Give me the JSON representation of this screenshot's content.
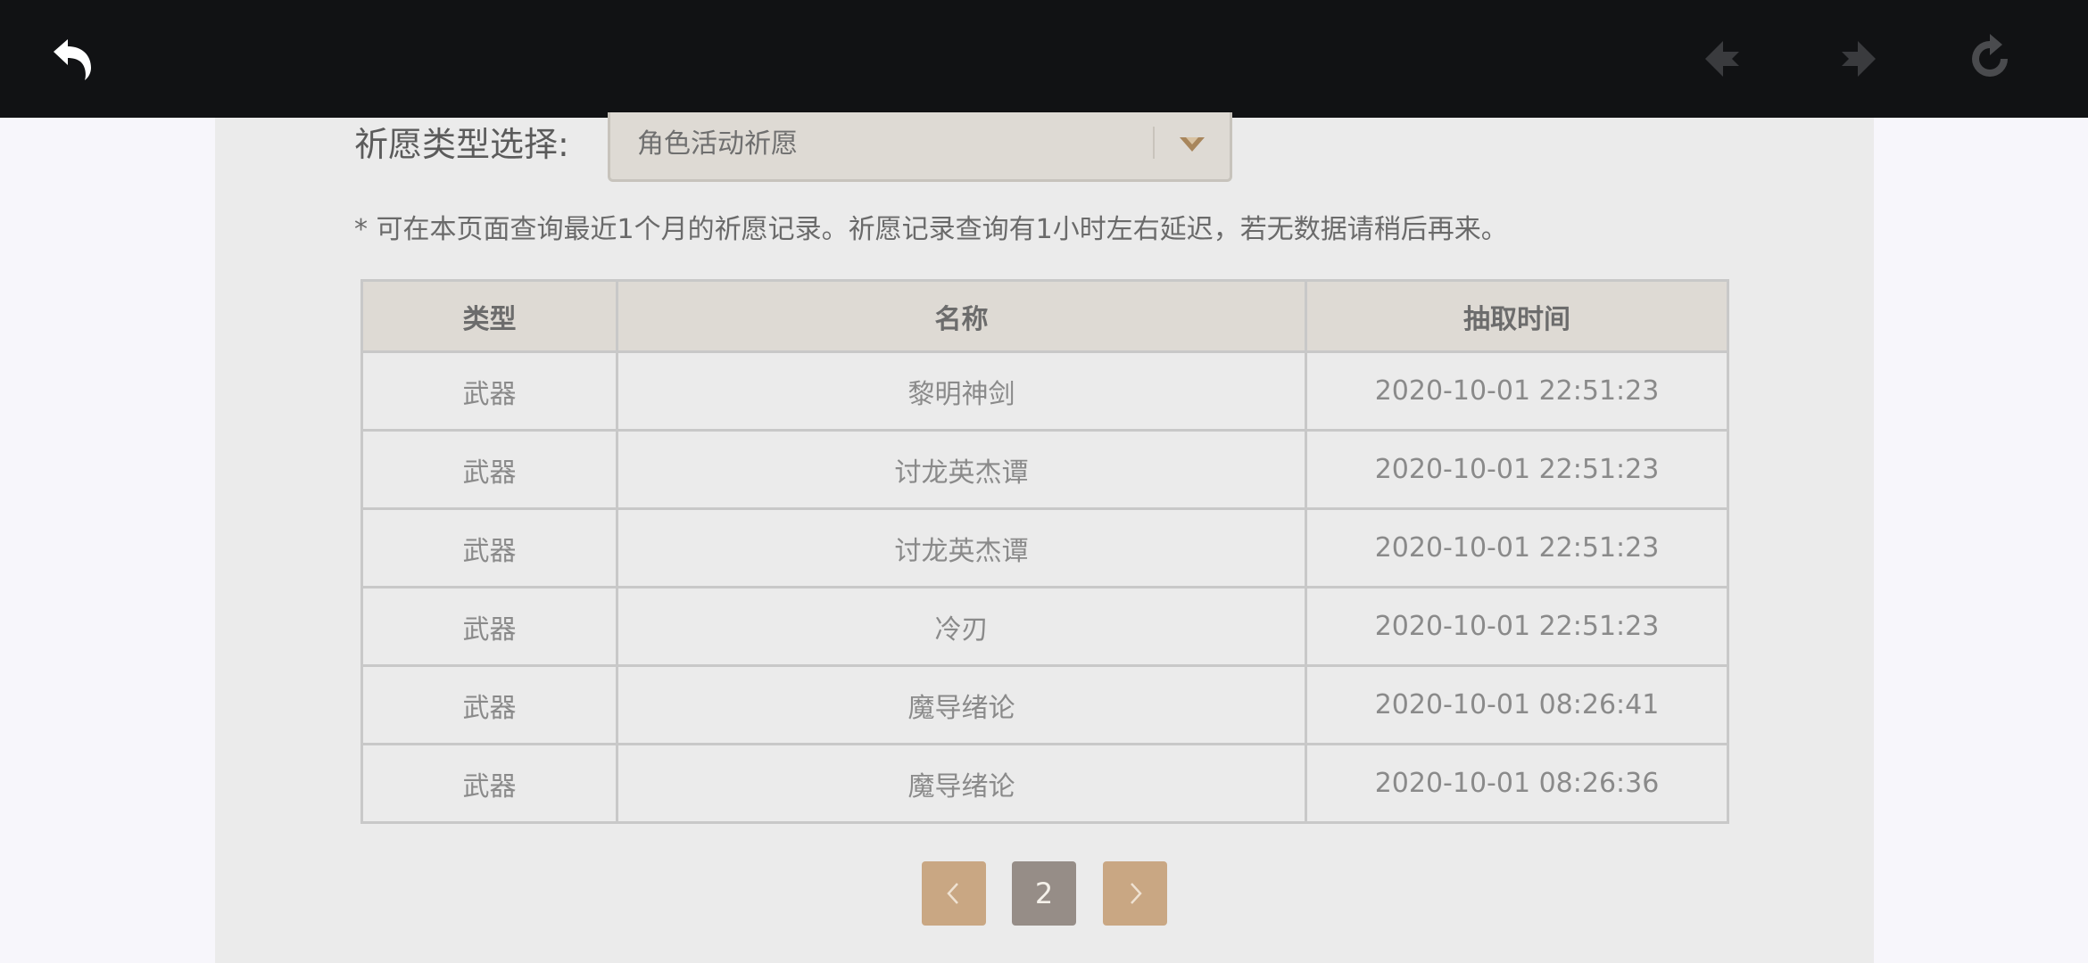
{
  "topbar": {
    "icons": [
      "back-icon",
      "prev-arrow-icon",
      "next-arrow-icon",
      "refresh-icon"
    ],
    "background": "#111214"
  },
  "filter": {
    "label": "祈愿类型选择:",
    "selected": "角色活动祈愿"
  },
  "notice": "* 可在本页面查询最近1个月的祈愿记录。祈愿记录查询有1小时左右延迟，若无数据请稍后再来。",
  "table": {
    "headers": [
      "类型",
      "名称",
      "抽取时间"
    ],
    "rows": [
      [
        "武器",
        "黎明神剑",
        "2020-10-01 22:51:23"
      ],
      [
        "武器",
        "讨龙英杰谭",
        "2020-10-01 22:51:23"
      ],
      [
        "武器",
        "讨龙英杰谭",
        "2020-10-01 22:51:23"
      ],
      [
        "武器",
        "冷刃",
        "2020-10-01 22:51:23"
      ],
      [
        "武器",
        "魔导绪论",
        "2020-10-01 08:26:41"
      ],
      [
        "武器",
        "魔导绪论",
        "2020-10-01 08:26:36"
      ]
    ]
  },
  "pagination": {
    "current_page": "2"
  },
  "colors": {
    "accent": "#c9a783",
    "current_page": "#968d87",
    "header_bg": "#dedad4"
  }
}
